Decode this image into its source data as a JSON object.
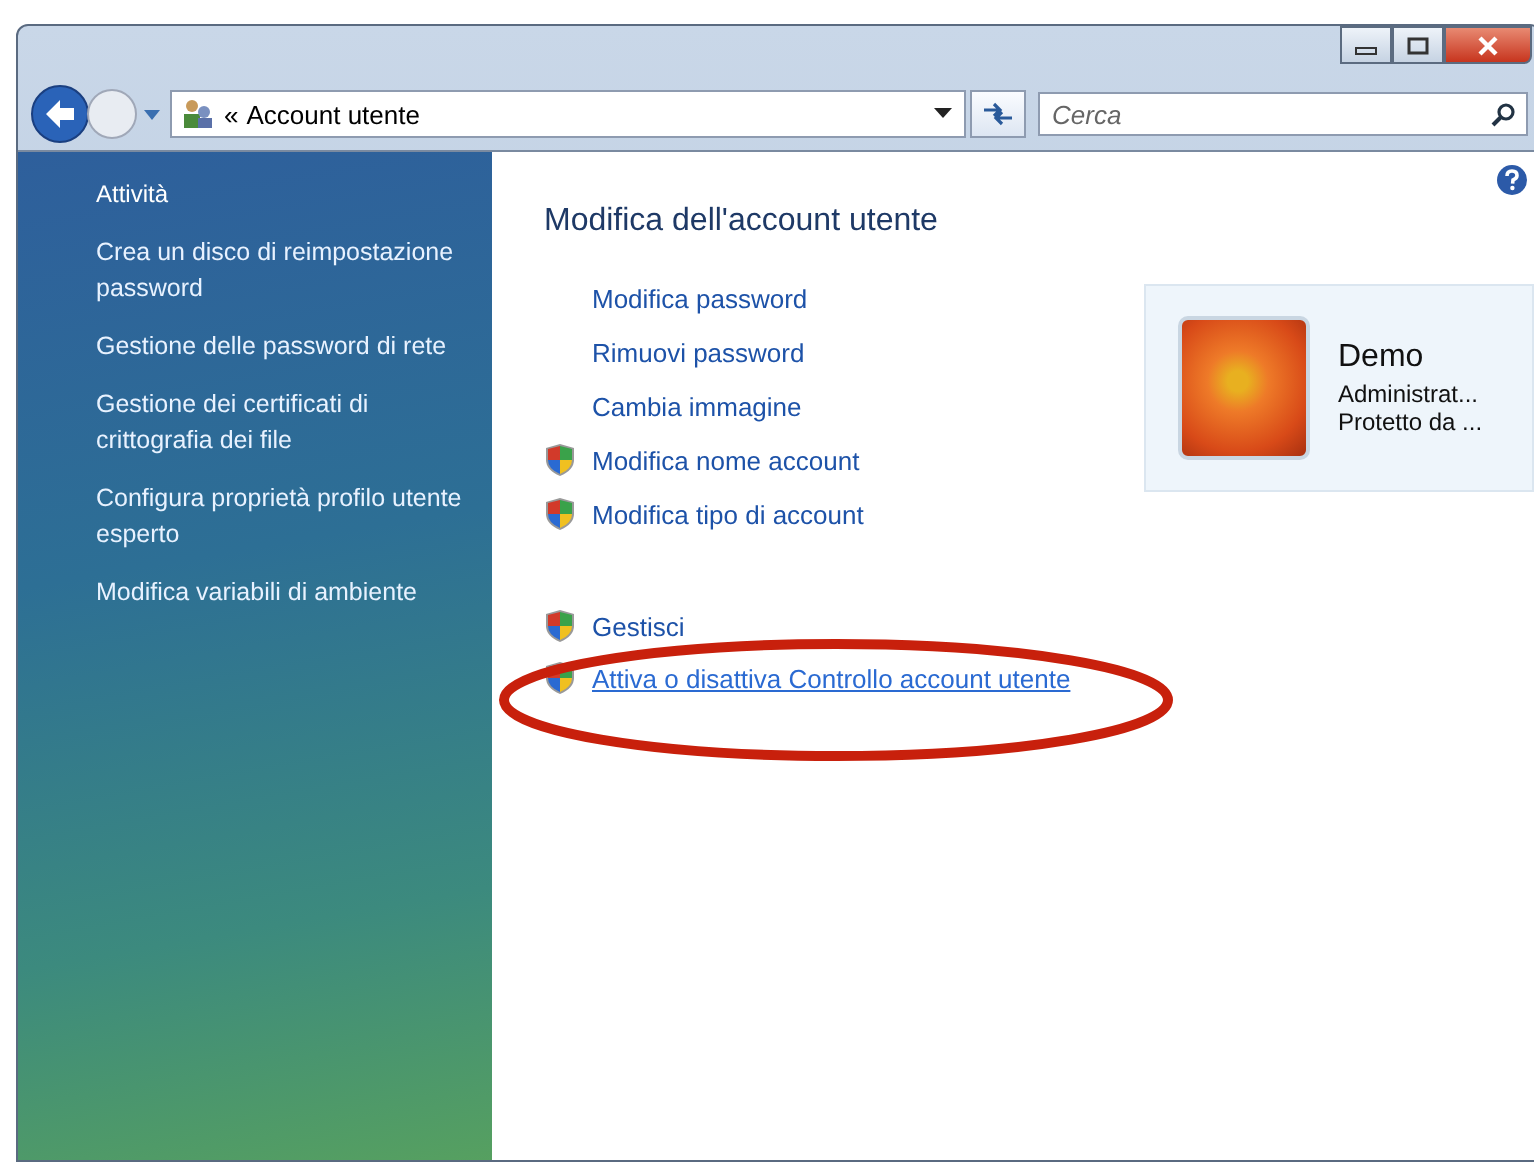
{
  "address_bar": {
    "path": "Account utente",
    "separator": "«"
  },
  "search": {
    "placeholder": "Cerca"
  },
  "sidebar": {
    "heading": "Attività",
    "items": [
      {
        "label": "Crea un disco di reimpostazione password"
      },
      {
        "label": "Gestione delle password di rete"
      },
      {
        "label": "Gestione dei certificati di crittografia dei file"
      },
      {
        "label": "Configura proprietà profilo utente esperto"
      },
      {
        "label": "Modifica variabili di ambiente"
      }
    ]
  },
  "main": {
    "title": "Modifica dell'account utente",
    "links": [
      {
        "label": "Modifica password",
        "shield": false,
        "hovered": false
      },
      {
        "label": "Rimuovi password",
        "shield": false,
        "hovered": false
      },
      {
        "label": "Cambia immagine",
        "shield": false,
        "hovered": false
      },
      {
        "label": "Modifica nome account",
        "shield": true,
        "hovered": false
      },
      {
        "label": "Modifica tipo di account",
        "shield": true,
        "hovered": false
      }
    ],
    "more_links": [
      {
        "label": "Gestisci",
        "shield": true,
        "hovered": false
      },
      {
        "label": "Attiva o disattiva Controllo account utente",
        "shield": true,
        "hovered": true
      }
    ]
  },
  "account": {
    "name": "Demo",
    "type": "Administrat...",
    "status": "Protetto da ..."
  }
}
